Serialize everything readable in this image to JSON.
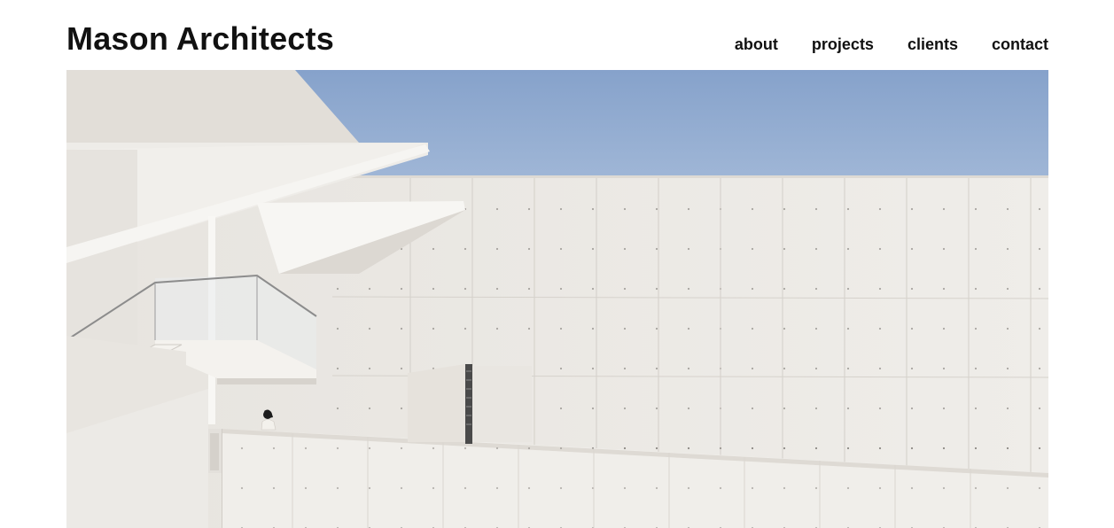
{
  "site": {
    "title": "Mason Architects"
  },
  "nav": {
    "items": [
      {
        "label": "about"
      },
      {
        "label": "projects"
      },
      {
        "label": "clients"
      },
      {
        "label": "contact"
      }
    ]
  },
  "hero": {
    "image": "white-concrete-building-with-blue-sky",
    "colors": {
      "sky_top": "#86a2cb",
      "sky_bottom": "#a2b8d8",
      "concrete": "#eceae6",
      "concrete_shade": "#dcd9d4",
      "concrete_dark": "#c9c5bf"
    }
  }
}
